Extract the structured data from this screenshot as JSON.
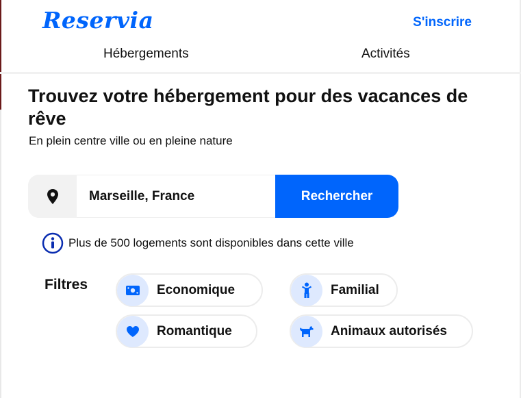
{
  "header": {
    "logo": "Reservia",
    "signup_label": "S'inscrire",
    "tabs": [
      {
        "label": "Hébergements"
      },
      {
        "label": "Activités"
      }
    ]
  },
  "hero": {
    "title": "Trouvez votre hébergement pour des vacances de rêve",
    "subtitle": "En plein centre ville ou en pleine nature"
  },
  "search": {
    "icon": "location-pin-icon",
    "value": "Marseille, France",
    "button_label": "Rechercher"
  },
  "info": {
    "icon": "info-icon",
    "text": "Plus de 500 logements sont disponibles dans cette ville"
  },
  "filters": {
    "label": "Filtres",
    "items": [
      {
        "label": "Economique",
        "icon": "money-icon"
      },
      {
        "label": "Familial",
        "icon": "child-icon"
      },
      {
        "label": "Romantique",
        "icon": "heart-icon"
      },
      {
        "label": "Animaux autorisés",
        "icon": "dog-icon"
      }
    ]
  },
  "colors": {
    "accent": "#0065fc",
    "chip_icon_bg": "#dee9fe",
    "search_icon_bg": "#f2f2f2"
  }
}
